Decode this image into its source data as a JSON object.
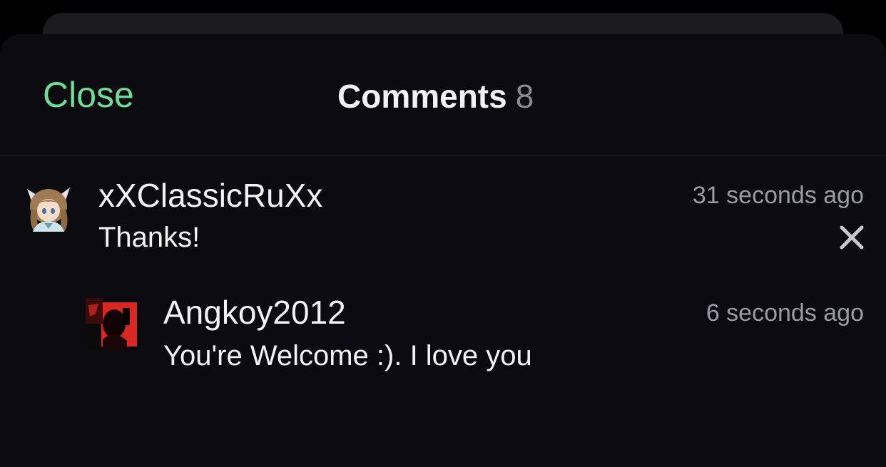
{
  "header": {
    "close_label": "Close",
    "title": "Comments",
    "count": "8"
  },
  "comments": [
    {
      "username": "xXClassicRuXx",
      "text": "Thanks!",
      "time": "31 seconds ago",
      "avatar": "anime-girl-avatar",
      "delete_icon": "close-icon"
    },
    {
      "username": "Angkoy2012",
      "text": "You're Welcome :). I love you",
      "time": "6 seconds ago",
      "avatar": "red-dark-avatar"
    }
  ],
  "colors": {
    "accent": "#6fdc9a",
    "background": "#0b0b10",
    "text": "#f2f2f4",
    "muted": "#9b9ba3"
  }
}
